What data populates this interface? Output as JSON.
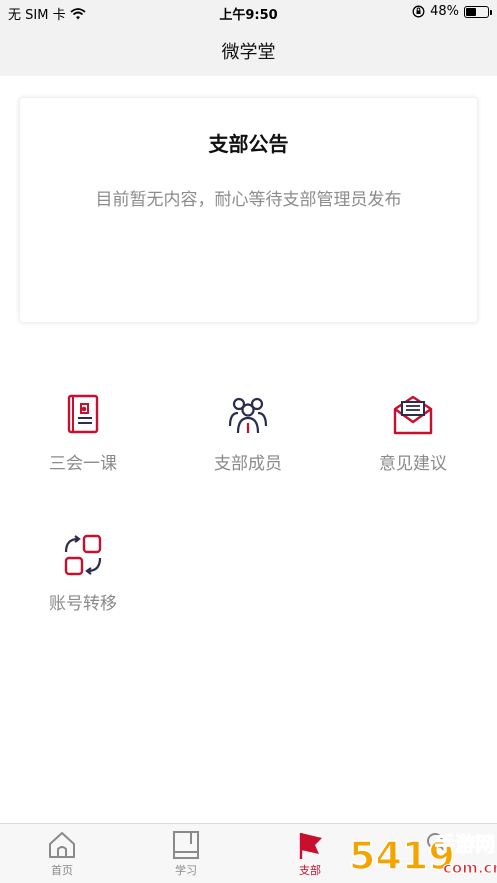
{
  "status_bar": {
    "carrier": "无 SIM 卡",
    "time": "上午9:50",
    "battery_percent": "48%",
    "battery_level": 0.48
  },
  "nav": {
    "title": "微学堂"
  },
  "notice": {
    "title": "支部公告",
    "empty_text": "目前暂无内容，耐心等待支部管理员发布"
  },
  "functions": [
    {
      "label": "三会一课",
      "icon": "party-book-icon"
    },
    {
      "label": "支部成员",
      "icon": "members-icon"
    },
    {
      "label": "意见建议",
      "icon": "mail-icon"
    },
    {
      "label": "账号转移",
      "icon": "transfer-icon"
    }
  ],
  "tabs": [
    {
      "label": "首页",
      "icon": "home-icon",
      "active": false
    },
    {
      "label": "学习",
      "icon": "book-icon",
      "active": false
    },
    {
      "label": "支部",
      "icon": "flag-icon",
      "active": true
    },
    {
      "label": "",
      "icon": "search-icon",
      "active": false
    }
  ],
  "watermark": {
    "text_main": "手游网",
    "text_sub": "com.cn",
    "number": "5419"
  },
  "colors": {
    "accent": "#c8102e",
    "icon_dark": "#2b2d4a",
    "text_gray": "#8a8a8a",
    "header_bg": "#f2f2f2"
  }
}
